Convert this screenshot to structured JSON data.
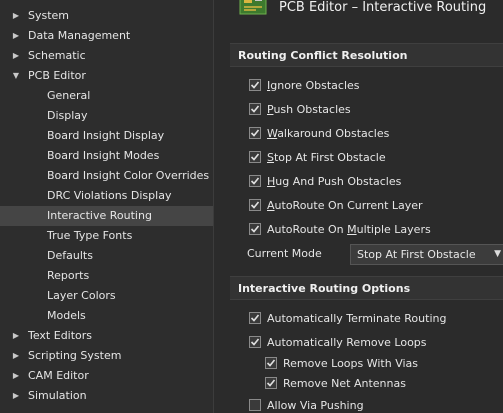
{
  "tree": {
    "items": [
      {
        "label": "System",
        "level": 0,
        "arrow": "▶"
      },
      {
        "label": "Data Management",
        "level": 0,
        "arrow": "▶"
      },
      {
        "label": "Schematic",
        "level": 0,
        "arrow": "▶"
      },
      {
        "label": "PCB Editor",
        "level": 0,
        "arrow": "▼"
      },
      {
        "label": "General",
        "level": 1
      },
      {
        "label": "Display",
        "level": 1
      },
      {
        "label": "Board Insight Display",
        "level": 1
      },
      {
        "label": "Board Insight Modes",
        "level": 1
      },
      {
        "label": "Board Insight Color Overrides",
        "level": 1
      },
      {
        "label": "DRC Violations Display",
        "level": 1
      },
      {
        "label": "Interactive Routing",
        "level": 1,
        "selected": true
      },
      {
        "label": "True Type Fonts",
        "level": 1
      },
      {
        "label": "Defaults",
        "level": 1
      },
      {
        "label": "Reports",
        "level": 1
      },
      {
        "label": "Layer Colors",
        "level": 1
      },
      {
        "label": "Models",
        "level": 1
      },
      {
        "label": "Text Editors",
        "level": 0,
        "arrow": "▶"
      },
      {
        "label": "Scripting System",
        "level": 0,
        "arrow": "▶"
      },
      {
        "label": "CAM Editor",
        "level": 0,
        "arrow": "▶"
      },
      {
        "label": "Simulation",
        "level": 0,
        "arrow": "▶"
      }
    ]
  },
  "header": {
    "title": "PCB Editor – Interactive Routing"
  },
  "routing_conflict": {
    "title": "Routing Conflict Resolution",
    "options": [
      {
        "pre": "",
        "u": "I",
        "post": "gnore Obstacles",
        "checked": true
      },
      {
        "pre": "",
        "u": "P",
        "post": "ush Obstacles",
        "checked": true
      },
      {
        "pre": "",
        "u": "W",
        "post": "alkaround Obstacles",
        "checked": true
      },
      {
        "pre": "",
        "u": "S",
        "post": "top At First Obstacle",
        "checked": true
      },
      {
        "pre": "",
        "u": "H",
        "post": "ug And Push Obstacles",
        "checked": true
      },
      {
        "pre": "",
        "u": "A",
        "post": "utoRoute On Current Layer",
        "checked": true
      },
      {
        "pre": "AutoRoute On ",
        "u": "M",
        "post": "ultiple Layers",
        "checked": true
      }
    ],
    "current_mode_label": "Current Mode",
    "current_mode_value": "Stop At First Obstacle"
  },
  "interactive_options": {
    "title": "Interactive Routing Options",
    "options": [
      {
        "label": "Automatically Terminate Routing",
        "checked": true,
        "indent": 0
      },
      {
        "label": "Automatically Remove Loops",
        "checked": true,
        "indent": 0
      },
      {
        "label": "Remove Loops With Vias",
        "checked": true,
        "indent": 1
      },
      {
        "label": "Remove Net Antennas",
        "checked": true,
        "indent": 1
      }
    ],
    "allow_via": {
      "label": "Allow Via Pushing",
      "checked": false
    }
  }
}
